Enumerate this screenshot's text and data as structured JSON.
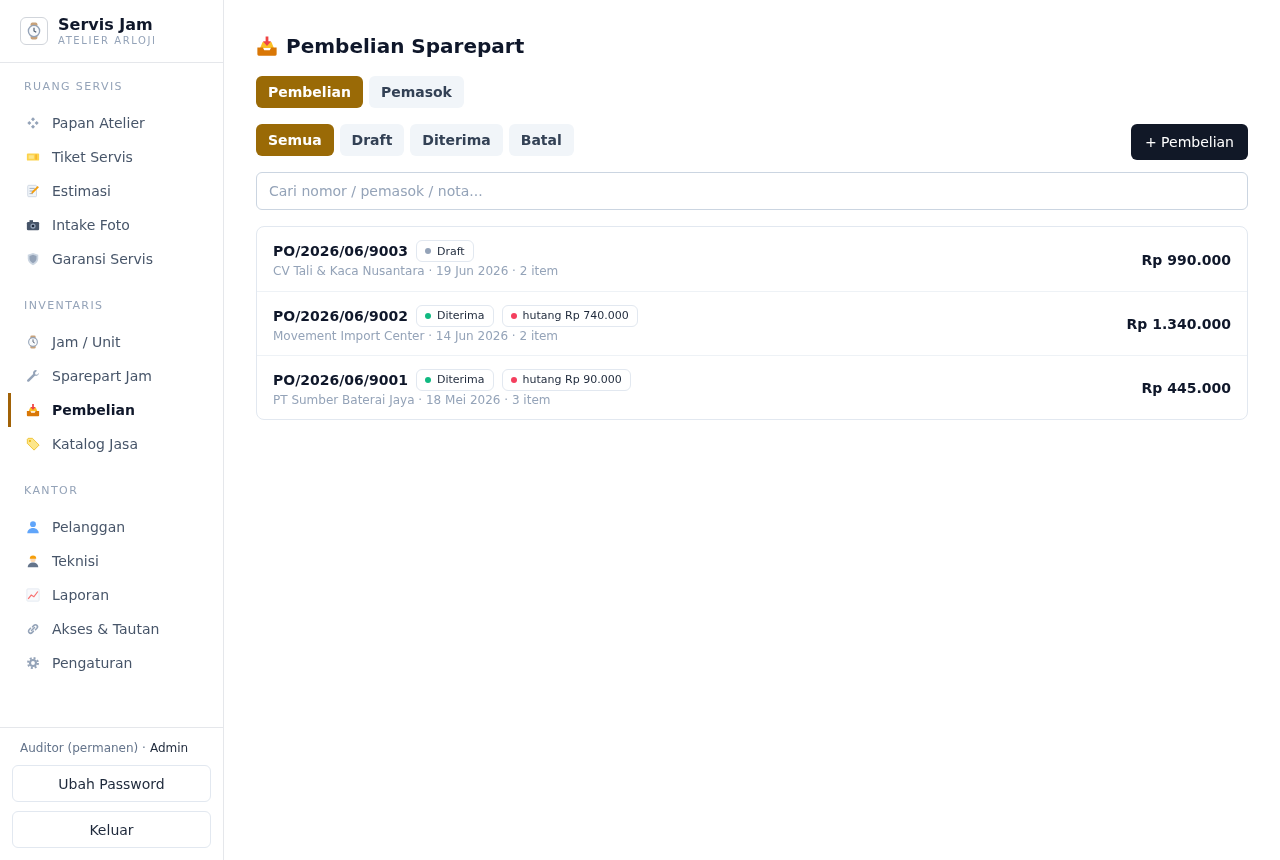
{
  "sidebar": {
    "brand": {
      "name": "Servis Jam",
      "tagline": "ATELIER ARLOJI"
    },
    "sections": [
      {
        "title": "RUANG SERVIS",
        "items": [
          {
            "label": "Papan Atelier",
            "selected": false
          },
          {
            "label": "Tiket Servis",
            "selected": false
          },
          {
            "label": "Estimasi",
            "selected": false
          },
          {
            "label": "Intake Foto",
            "selected": false
          },
          {
            "label": "Garansi Servis",
            "selected": false
          }
        ]
      },
      {
        "title": "INVENTARIS",
        "items": [
          {
            "label": "Jam / Unit",
            "selected": false
          },
          {
            "label": "Sparepart Jam",
            "selected": false
          },
          {
            "label": "Pembelian",
            "selected": true
          },
          {
            "label": "Katalog Jasa",
            "selected": false
          }
        ]
      },
      {
        "title": "KANTOR",
        "items": [
          {
            "label": "Pelanggan",
            "selected": false
          },
          {
            "label": "Teknisi",
            "selected": false
          },
          {
            "label": "Laporan",
            "selected": false
          },
          {
            "label": "Akses & Tautan",
            "selected": false
          },
          {
            "label": "Pengaturan",
            "selected": false
          }
        ]
      }
    ],
    "account": {
      "user": "Auditor (permanen) ·",
      "role": "Admin"
    },
    "buttons": [
      "Ubah Password",
      "Keluar"
    ]
  },
  "main": {
    "title": "Pembelian Sparepart",
    "tabs": [
      {
        "label": "Pembelian",
        "selected": true
      },
      {
        "label": "Pemasok",
        "selected": false
      }
    ],
    "filters": [
      {
        "label": "Semua",
        "selected": true
      },
      {
        "label": "Draft",
        "selected": false
      },
      {
        "label": "Diterima",
        "selected": false
      },
      {
        "label": "Batal",
        "selected": false
      }
    ],
    "new_button": "+ Pembelian",
    "search": {
      "placeholder": "Cari nomor / pemasok / nota..."
    },
    "orders": [
      {
        "number": "PO/2026/06/9003",
        "badges": [
          {
            "label": "Draft",
            "color": "#94a3b8"
          }
        ],
        "details": "CV Tali & Kaca Nusantara · 19 Jun 2026 · 2 item",
        "total": "Rp 990.000"
      },
      {
        "number": "PO/2026/06/9002",
        "badges": [
          {
            "label": "Diterima",
            "color": "#10b981"
          },
          {
            "label": "hutang Rp 740.000",
            "color": "#f43f5e"
          }
        ],
        "details": "Movement Import Center · 14 Jun 2026 · 2 item",
        "total": "Rp 1.340.000"
      },
      {
        "number": "PO/2026/06/9001",
        "badges": [
          {
            "label": "Diterima",
            "color": "#10b981"
          },
          {
            "label": "hutang Rp 90.000",
            "color": "#f43f5e"
          }
        ],
        "details": "PT Sumber Baterai Jaya · 18 Mei 2026 · 3 item",
        "total": "Rp 445.000"
      }
    ]
  }
}
